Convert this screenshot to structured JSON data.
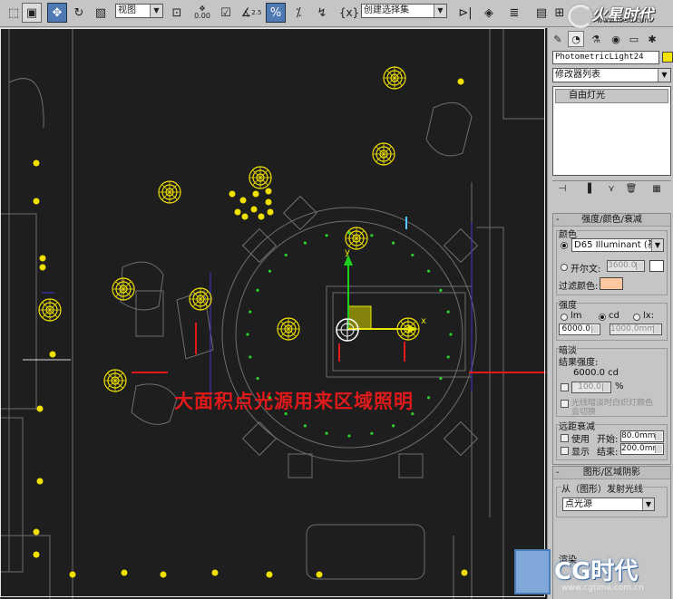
{
  "toolbar": {
    "view_dropdown": "视图",
    "selection_set": "创建选择集",
    "snap_value": "2.5",
    "percent_snap": "%",
    "coord_readout": "0.00"
  },
  "site_logo": {
    "text": "火星时代",
    "url": "www.hxsd.com"
  },
  "viewport": {
    "annotation": "大面积点光源用来区域照明",
    "axis_y": "y",
    "axis_x": "x"
  },
  "panel": {
    "object_name": "PhotometricLight24",
    "object_color": "#f5e400",
    "modifier_list": "修改器列表",
    "stack_item": "自由灯光",
    "intensity_rollout": {
      "title": "强度/颜色/衰减",
      "color_group": "颜色",
      "illuminant": "D65 Illuminant (基",
      "kelvin_label": "开尔文:",
      "kelvin_value": "3600.0",
      "filter_label": "过滤颜色:",
      "filter_color": "#ffc8a0",
      "kelvin_swatch": "#ffffff",
      "strength_group": "强度",
      "unit_lm": "lm",
      "unit_cd": "cd",
      "unit_lx": "lx:",
      "cd_value": "6000.0",
      "lx_value": "1000.0mm",
      "dimming_group": "暗淡",
      "result_label": "结果强度:",
      "result_value": "6000.0 cd",
      "percent_value": "100.0",
      "percent_sign": "%",
      "incandescent_label": "光线暗淡时白炽灯颜色",
      "incandescent_label2": "会切换",
      "far_atten_group": "远距衰减",
      "use_label": "使用",
      "show_label": "显示",
      "start_label": "开始:",
      "start_value": "80.0mm",
      "end_label": "结束:",
      "end_value": "200.0mm"
    },
    "shape_rollout": {
      "title": "图形/区域阴影",
      "emit_label": "从（图形）发射光线",
      "shape_value": "点光源",
      "render_label": "渲染"
    }
  },
  "cg_logo": {
    "text": "CG时代",
    "url": "www.cgtime.com.cn"
  },
  "colors": {
    "viewport_bg": "#1e1e1e",
    "light_yellow": "#f0e000",
    "annotation_red": "#e01a1a",
    "panel_bg": "#c5c5c5"
  }
}
